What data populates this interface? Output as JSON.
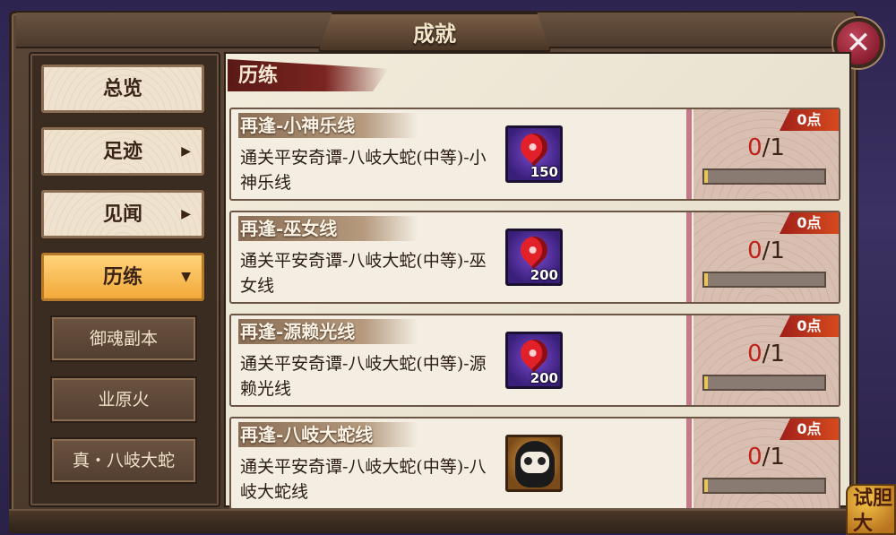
{
  "title": "成就",
  "sidebar": {
    "tabs": [
      {
        "label": "总览",
        "arrow": ""
      },
      {
        "label": "足迹",
        "arrow": "▶"
      },
      {
        "label": "见闻",
        "arrow": "▶"
      },
      {
        "label": "历练",
        "arrow": "▼"
      }
    ],
    "subtabs": [
      "御魂副本",
      "业原火",
      "真・八岐大蛇"
    ]
  },
  "section": {
    "title": "历练"
  },
  "cards": [
    {
      "title": "再逢-小神乐线",
      "desc": "通关平安奇谭-八岐大蛇(中等)-小神乐线",
      "reward_count": "150",
      "points": "0点",
      "progress_current": "0",
      "progress_total": "/1"
    },
    {
      "title": "再逢-巫女线",
      "desc": "通关平安奇谭-八岐大蛇(中等)-巫女线",
      "reward_count": "200",
      "points": "0点",
      "progress_current": "0",
      "progress_total": "/1"
    },
    {
      "title": "再逢-源赖光线",
      "desc": "通关平安奇谭-八岐大蛇(中等)-源赖光线",
      "reward_count": "200",
      "points": "0点",
      "progress_current": "0",
      "progress_total": "/1"
    },
    {
      "title": "再逢-八岐大蛇线",
      "desc": "通关平安奇谭-八岐大蛇(中等)-八岐大蛇线",
      "reward_count": "",
      "points": "0点",
      "progress_current": "0",
      "progress_total": "/1"
    }
  ],
  "corner_button": "试胆大"
}
